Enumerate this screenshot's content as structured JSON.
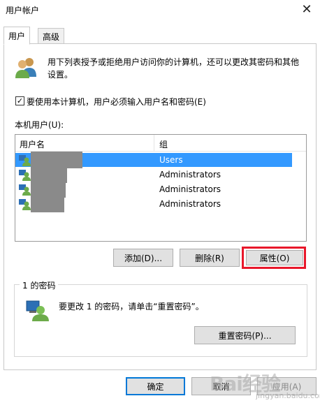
{
  "window": {
    "title": "用户帐户"
  },
  "tabs": [
    {
      "label": "用户",
      "active": true
    },
    {
      "label": "高级",
      "active": false
    }
  ],
  "description": "用下列表授予或拒绝用户访问你的计算机，还可以更改其密码和其他设置。",
  "require_password_checkbox": {
    "label": "要使用本计算机，用户必须输入用户名和密码(E)",
    "checked": true
  },
  "users_section": {
    "label": "本机用户(U):",
    "columns": [
      "用户名",
      "组"
    ],
    "rows": [
      {
        "group": "Users",
        "selected": true
      },
      {
        "group": "Administrators",
        "selected": false
      },
      {
        "group": "Administrators",
        "selected": false
      },
      {
        "group": "Administrators",
        "selected": false
      }
    ]
  },
  "buttons": {
    "add": "添加(D)...",
    "remove": "删除(R)",
    "properties": "属性(O)"
  },
  "password_group": {
    "title": "1 的密码",
    "text": "要更改 1 的密码，请单击“重置密码”。",
    "reset_button": "重置密码(P)..."
  },
  "footer": {
    "ok": "确定",
    "cancel": "取消",
    "apply": "应用(A)"
  },
  "watermark": {
    "text": "Bai经验",
    "sub": "jingyan.baidu.com"
  },
  "colors": {
    "selection": "#3399ff",
    "highlight": "#e8172a",
    "accent": "#0078d7"
  }
}
